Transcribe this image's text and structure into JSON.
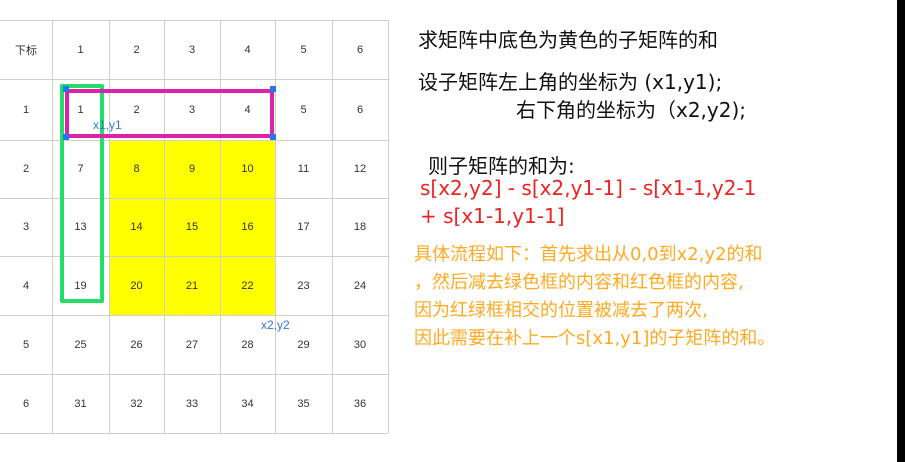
{
  "grid": {
    "header_row": [
      "下标",
      "1",
      "2",
      "3",
      "4",
      "5",
      "6"
    ],
    "rows": [
      [
        "1",
        "1",
        "2",
        "3",
        "4",
        "5",
        "6"
      ],
      [
        "2",
        "7",
        "8",
        "9",
        "10",
        "11",
        "12"
      ],
      [
        "3",
        "13",
        "14",
        "15",
        "16",
        "17",
        "18"
      ],
      [
        "4",
        "19",
        "20",
        "21",
        "22",
        "23",
        "24"
      ],
      [
        "5",
        "25",
        "26",
        "27",
        "28",
        "29",
        "30"
      ],
      [
        "6",
        "31",
        "32",
        "33",
        "34",
        "35",
        "36"
      ]
    ],
    "label_top_left": "x1,y1",
    "label_bottom_right": "x2,y2",
    "colors": {
      "highlight": "#ffff00",
      "green_frame": "#22dd66",
      "magenta_frame": "#dd22aa",
      "label_blue": "#3377dd"
    }
  },
  "explanation": {
    "line1": "求矩阵中底色为黄色的子矩阵的和",
    "line2": "设子矩阵左上角的坐标为 (x1,y1);",
    "line3": "右下角的坐标为（x2,y2);",
    "formula_title": "则子矩阵的和为:",
    "formula_line1": "s[x2,y2]  - s[x2,y1-1] - s[x1-1,y2-1",
    "formula_line2": "+ s[x1-1,y1-1]",
    "process_line1": "具体流程如下：首先求出从0,0到x2,y2的和",
    "process_line2": "，然后减去绿色框的内容和红色框的内容,",
    "process_line3": "因为红绿框相交的位置被减去了两次,",
    "process_line4": "因此需要在补上一个s[x1,y1]的子矩阵的和。",
    "colors": {
      "text": "#111111",
      "formula": "#ee2222",
      "process": "#ffaa22"
    }
  }
}
